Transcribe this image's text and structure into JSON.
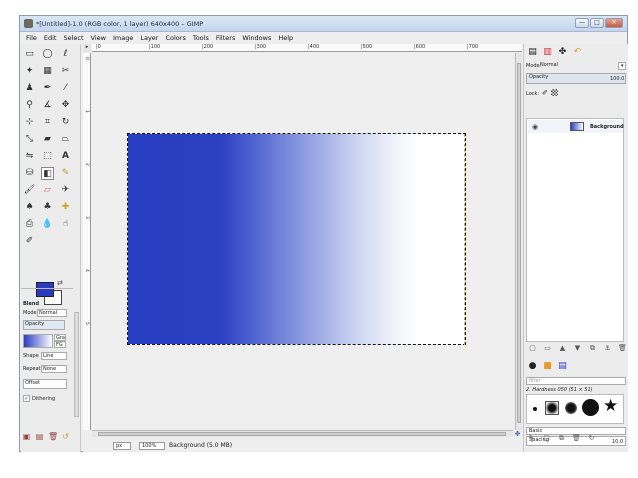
{
  "window": {
    "title": "*[Untitled]-1.0 (RGB color, 1 layer) 640x400 – GIMP",
    "controls": {
      "minimize": "—",
      "maximize": "□",
      "close": "✕"
    }
  },
  "menu": [
    "File",
    "Edit",
    "Select",
    "View",
    "Image",
    "Layer",
    "Colors",
    "Tools",
    "Filters",
    "Windows",
    "Help"
  ],
  "rulers": {
    "h_labels": [
      "|0",
      "|100",
      "|200",
      "|300",
      "|400",
      "|500",
      "|600",
      "|700"
    ],
    "v_labels": [
      "0",
      "1",
      "2",
      "3",
      "4",
      "5"
    ]
  },
  "tool_options": {
    "title": "Blend",
    "mode_label": "Mode",
    "mode_value": "Normal",
    "opacity_label": "Opacity",
    "gradient_value": "FG",
    "gradient_name": "Gra",
    "shape_label": "Shape",
    "shape_value": "Line",
    "repeat_label": "Repeat",
    "repeat_value": "None",
    "offset_label": "Offset",
    "dithering_label": "Dithering"
  },
  "status": {
    "unit": "px",
    "zoom": "100%",
    "message": "Background (5.0 MB)"
  },
  "layers": {
    "mode_label": "Mode:",
    "mode_value": "Normal",
    "opacity_label": "Opacity",
    "opacity_value": "100.0",
    "lock_label": "Lock:",
    "items": [
      {
        "name": "Background"
      }
    ]
  },
  "brushes": {
    "filter_placeholder": "filter",
    "brush_name": "2. Hardness 050 (51 × 51)",
    "preset": "Basic",
    "spacing_label": "Spacing",
    "spacing_value": "10.0"
  },
  "colors": {
    "foreground": "#2a3bbf",
    "background": "#ffffff",
    "gradient_start": "#2a3ec2",
    "gradient_end": "#ffffff"
  }
}
